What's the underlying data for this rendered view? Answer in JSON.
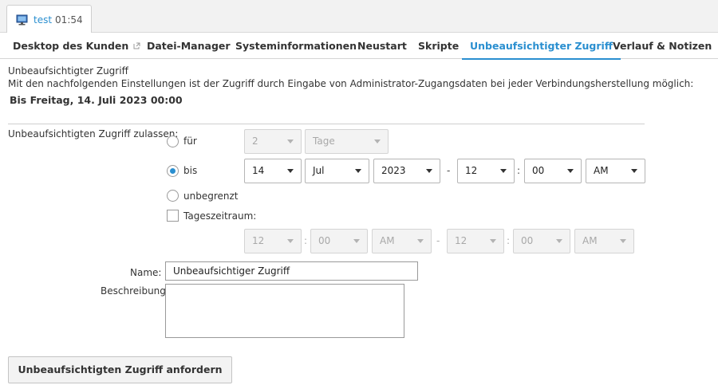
{
  "session": {
    "name": "test",
    "time": "01:54",
    "icon": "monitor-icon"
  },
  "tabs": [
    {
      "label": "Desktop des Kunden",
      "icon": "external-link-icon"
    },
    {
      "label": "Datei-Manager"
    },
    {
      "label": "Systeminformationen"
    },
    {
      "label": "Neustart"
    },
    {
      "label": "Skripte"
    },
    {
      "label": "Unbeaufsichtigter Zugriff",
      "active": true
    },
    {
      "label": "Verlauf & Notizen"
    }
  ],
  "section": {
    "title": "Unbeaufsichtigter Zugriff",
    "description": "Mit den nachfolgenden Einstellungen ist der Zugriff durch Eingabe von Administrator-Zugangsdaten bei jeder Verbindungsherstellung möglich:",
    "until": "Bis Freitag, 14. Juli 2023 00:00"
  },
  "form": {
    "allow_label": "Unbeaufsichtigten Zugriff zulassen:",
    "option_for": {
      "label": "für",
      "checked": false,
      "amount": "2",
      "unit": "Tage"
    },
    "option_until": {
      "label": "bis",
      "checked": true,
      "day": "14",
      "month": "Jul",
      "year": "2023",
      "dash": "-",
      "hour": "12",
      "colon": ":",
      "minute": "00",
      "ampm": "AM"
    },
    "option_unlimited": {
      "label": "unbegrenzt",
      "checked": false
    },
    "timeframe": {
      "label": "Tageszeitraum:",
      "checked": false,
      "from_hour": "12",
      "from_minute": "00",
      "from_ampm": "AM",
      "dash": "-",
      "colon": ":",
      "to_hour": "12",
      "to_minute": "00",
      "to_ampm": "AM"
    },
    "name_label": "Name:",
    "name_value": "Unbeaufsichtiger Zugriff",
    "description_label": "Beschreibung",
    "description_value": ""
  },
  "submit_label": "Unbeaufsichtigten Zugriff anfordern",
  "colors": {
    "accent": "#2a8fd0",
    "text": "#333333",
    "disabled": "#a8a8a8"
  }
}
